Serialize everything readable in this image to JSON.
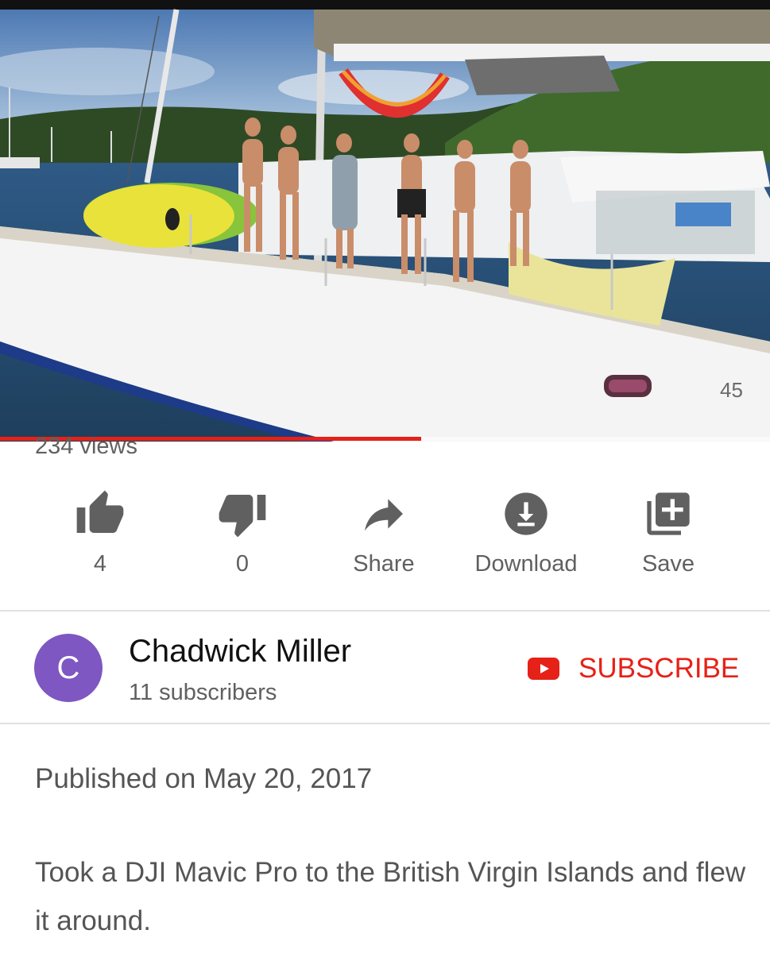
{
  "video": {
    "hull_number": "45",
    "progress_fraction": 0.547
  },
  "views_text": "234 views",
  "actions": {
    "like_count": "4",
    "dislike_count": "0",
    "share_label": "Share",
    "download_label": "Download",
    "save_label": "Save"
  },
  "channel": {
    "avatar_letter": "C",
    "name": "Chadwick Miller",
    "subscribers": "11 subscribers",
    "subscribe_label": "SUBSCRIBE"
  },
  "description": {
    "published": "Published on May 20, 2017",
    "text": "Took a DJI Mavic Pro to the British Virgin Islands and flew it around."
  },
  "colors": {
    "accent_red": "#e62117",
    "avatar_purple": "#7e57c2",
    "icon_gray": "#606060"
  }
}
